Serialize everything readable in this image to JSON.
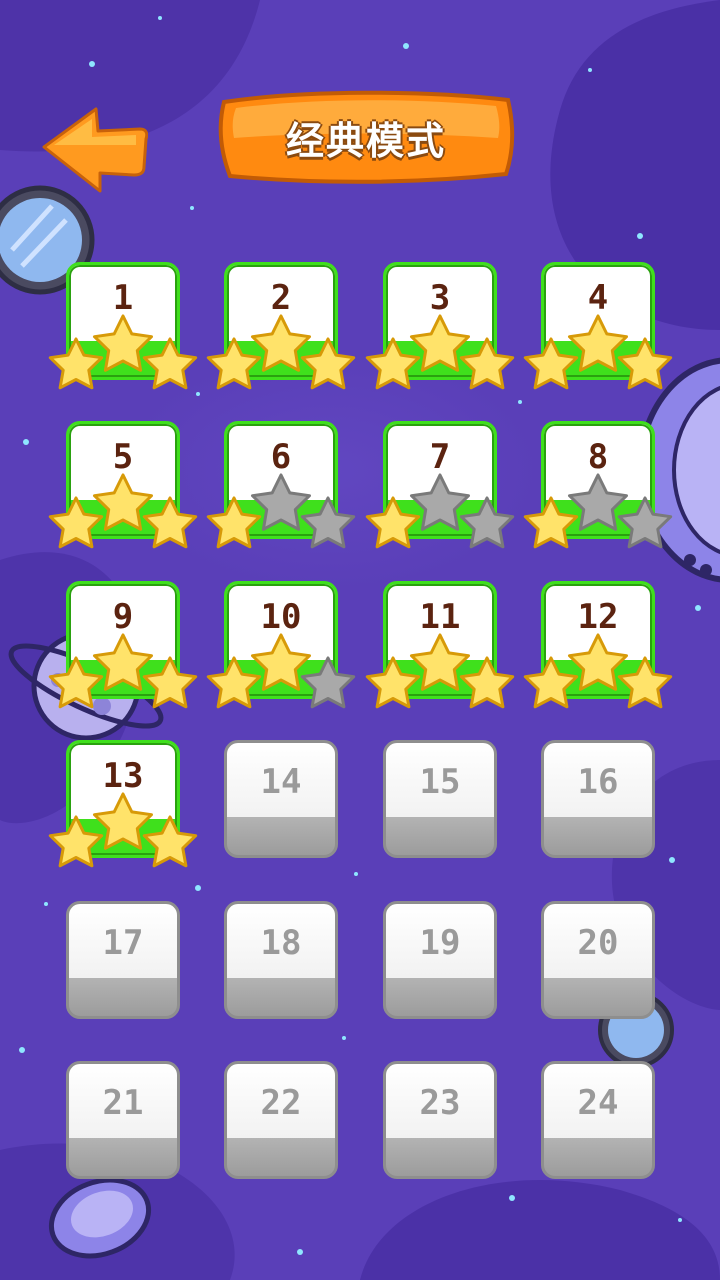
{
  "header": {
    "title": "经典模式",
    "back_icon": "arrow-left-icon"
  },
  "colors": {
    "background": "#5a3fb8",
    "unlocked_accent": "#3fe01c",
    "star_earned": "#ffe36a",
    "star_empty": "#a9a9a9",
    "title_banner": "#ff9a1f"
  },
  "levels": [
    {
      "number": "1",
      "locked": false,
      "stars": 3
    },
    {
      "number": "2",
      "locked": false,
      "stars": 3
    },
    {
      "number": "3",
      "locked": false,
      "stars": 3
    },
    {
      "number": "4",
      "locked": false,
      "stars": 3
    },
    {
      "number": "5",
      "locked": false,
      "stars": 3
    },
    {
      "number": "6",
      "locked": false,
      "stars": 1
    },
    {
      "number": "7",
      "locked": false,
      "stars": 1
    },
    {
      "number": "8",
      "locked": false,
      "stars": 1
    },
    {
      "number": "9",
      "locked": false,
      "stars": 3
    },
    {
      "number": "10",
      "locked": false,
      "stars": 2
    },
    {
      "number": "11",
      "locked": false,
      "stars": 3
    },
    {
      "number": "12",
      "locked": false,
      "stars": 3
    },
    {
      "number": "13",
      "locked": false,
      "stars": 3
    },
    {
      "number": "14",
      "locked": true,
      "stars": 0
    },
    {
      "number": "15",
      "locked": true,
      "stars": 0
    },
    {
      "number": "16",
      "locked": true,
      "stars": 0
    },
    {
      "number": "17",
      "locked": true,
      "stars": 0
    },
    {
      "number": "18",
      "locked": true,
      "stars": 0
    },
    {
      "number": "19",
      "locked": true,
      "stars": 0
    },
    {
      "number": "20",
      "locked": true,
      "stars": 0
    },
    {
      "number": "21",
      "locked": true,
      "stars": 0
    },
    {
      "number": "22",
      "locked": true,
      "stars": 0
    },
    {
      "number": "23",
      "locked": true,
      "stars": 0
    },
    {
      "number": "24",
      "locked": true,
      "stars": 0
    }
  ]
}
